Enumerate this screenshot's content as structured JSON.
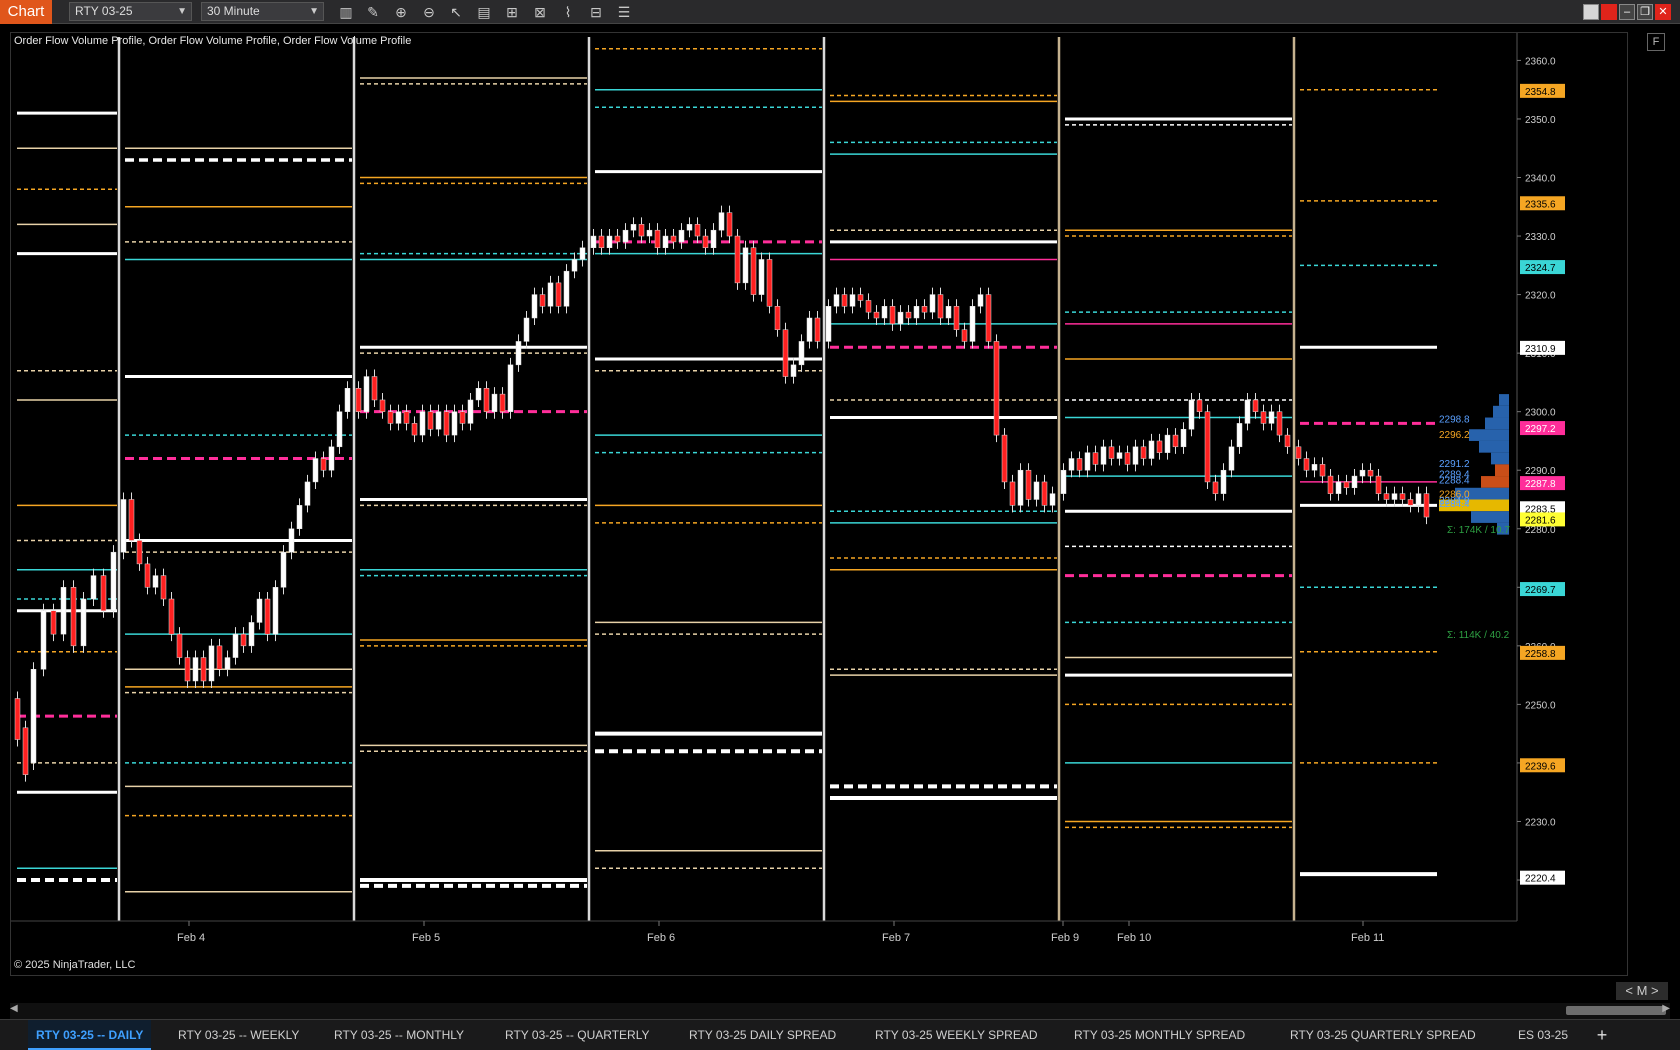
{
  "toolbar": {
    "chart_label": "Chart",
    "instrument": "RTY 03-25",
    "interval": "30 Minute",
    "tools": [
      "bar-type-icon",
      "draw-pencil-icon",
      "zoom-in-icon",
      "zoom-out-icon",
      "pointer-icon",
      "data-box-icon",
      "properties-icon",
      "indicators-icon",
      "strategies-icon",
      "templates-icon",
      "menu-list-icon"
    ],
    "window_buttons": [
      "minimize-gray-icon",
      "link-red-icon",
      "minimize-icon",
      "restore-icon",
      "close-icon"
    ]
  },
  "chart": {
    "indicator_label": "Order Flow Volume Profile, Order Flow Volume Profile, Order Flow Volume Profile",
    "copyright": "© 2025 NinjaTrader, LLC",
    "f_button": "F",
    "nav": "< M >",
    "colors": {
      "white": "#ffffff",
      "orange": "#f5a623",
      "cyan": "#3ad6d6",
      "magenta": "#ff2e9a",
      "tan": "#e8d2a8",
      "up_candle": "#ffffff",
      "down_candle": "#ff2020"
    }
  },
  "chart_data": {
    "type": "candlestick",
    "interval": "30 Minute",
    "instrument": "RTY 03-25",
    "y_axis": {
      "min": 2213,
      "max": 2364,
      "ticks": [
        2360.0,
        2350.0,
        2340.0,
        2330.0,
        2320.0,
        2310.0,
        2300.0,
        2290.0,
        2280.0,
        2270.0,
        2260.0,
        2250.0,
        2240.0,
        2230.0,
        2220.0
      ]
    },
    "x_axis": {
      "labels": [
        "Feb 4",
        "Feb 5",
        "Feb 6",
        "Feb 7",
        "Feb 9",
        "Feb 10",
        "Feb 11"
      ]
    },
    "price_markers": [
      {
        "value": "2354.8",
        "color": "#f5a623",
        "text": "#000000"
      },
      {
        "value": "2335.6",
        "color": "#f5a623",
        "text": "#000000"
      },
      {
        "value": "2324.7",
        "color": "#3ad6d6",
        "text": "#000000"
      },
      {
        "value": "2310.9",
        "color": "#ffffff",
        "text": "#000000"
      },
      {
        "value": "2297.2",
        "color": "#ff2e9a",
        "text": "#ffffff"
      },
      {
        "value": "2287.8",
        "color": "#ff2e9a",
        "text": "#ffffff"
      },
      {
        "value": "2283.5",
        "color": "#ffffff",
        "text": "#000000"
      },
      {
        "value": "2281.6",
        "color": "#ffff33",
        "text": "#000000"
      },
      {
        "value": "2269.7",
        "color": "#3ad6d6",
        "text": "#000000"
      },
      {
        "value": "2258.8",
        "color": "#f5a623",
        "text": "#000000"
      },
      {
        "value": "2239.6",
        "color": "#f5a623",
        "text": "#000000"
      },
      {
        "value": "2220.4",
        "color": "#ffffff",
        "text": "#000000"
      }
    ],
    "profile_labels": [
      {
        "value": "2298.8",
        "color": "#5aa0ff"
      },
      {
        "value": "2296.2",
        "color": "#f5a623"
      },
      {
        "value": "2291.2",
        "color": "#5aa0ff"
      },
      {
        "value": "2289.4",
        "color": "#5aa0ff"
      },
      {
        "value": "2288.4",
        "color": "#5aa0ff"
      },
      {
        "value": "2286.0",
        "color": "#f5a623"
      },
      {
        "value": "2284.9",
        "color": "#5aa0ff"
      },
      {
        "value": "2284.4",
        "color": "#5aa0ff"
      }
    ],
    "profile_volume": [
      {
        "text": "Σ: 174K / 10.7",
        "color": "#2ea043"
      },
      {
        "text": "Σ: 114K / 40.2",
        "color": "#2ea043"
      }
    ]
  },
  "tabs": [
    {
      "label": "RTY 03-25 -- DAILY",
      "active": true
    },
    {
      "label": "RTY 03-25 -- WEEKLY"
    },
    {
      "label": "RTY 03-25 -- MONTHLY"
    },
    {
      "label": "RTY 03-25 -- QUARTERLY"
    },
    {
      "label": "RTY 03-25 DAILY SPREAD"
    },
    {
      "label": "RTY 03-25 WEEKLY SPREAD"
    },
    {
      "label": "RTY 03-25 MONTHLY SPREAD"
    },
    {
      "label": "RTY 03-25 QUARTERLY SPREAD"
    },
    {
      "label": "ES 03-25"
    }
  ],
  "add_tab": "+"
}
